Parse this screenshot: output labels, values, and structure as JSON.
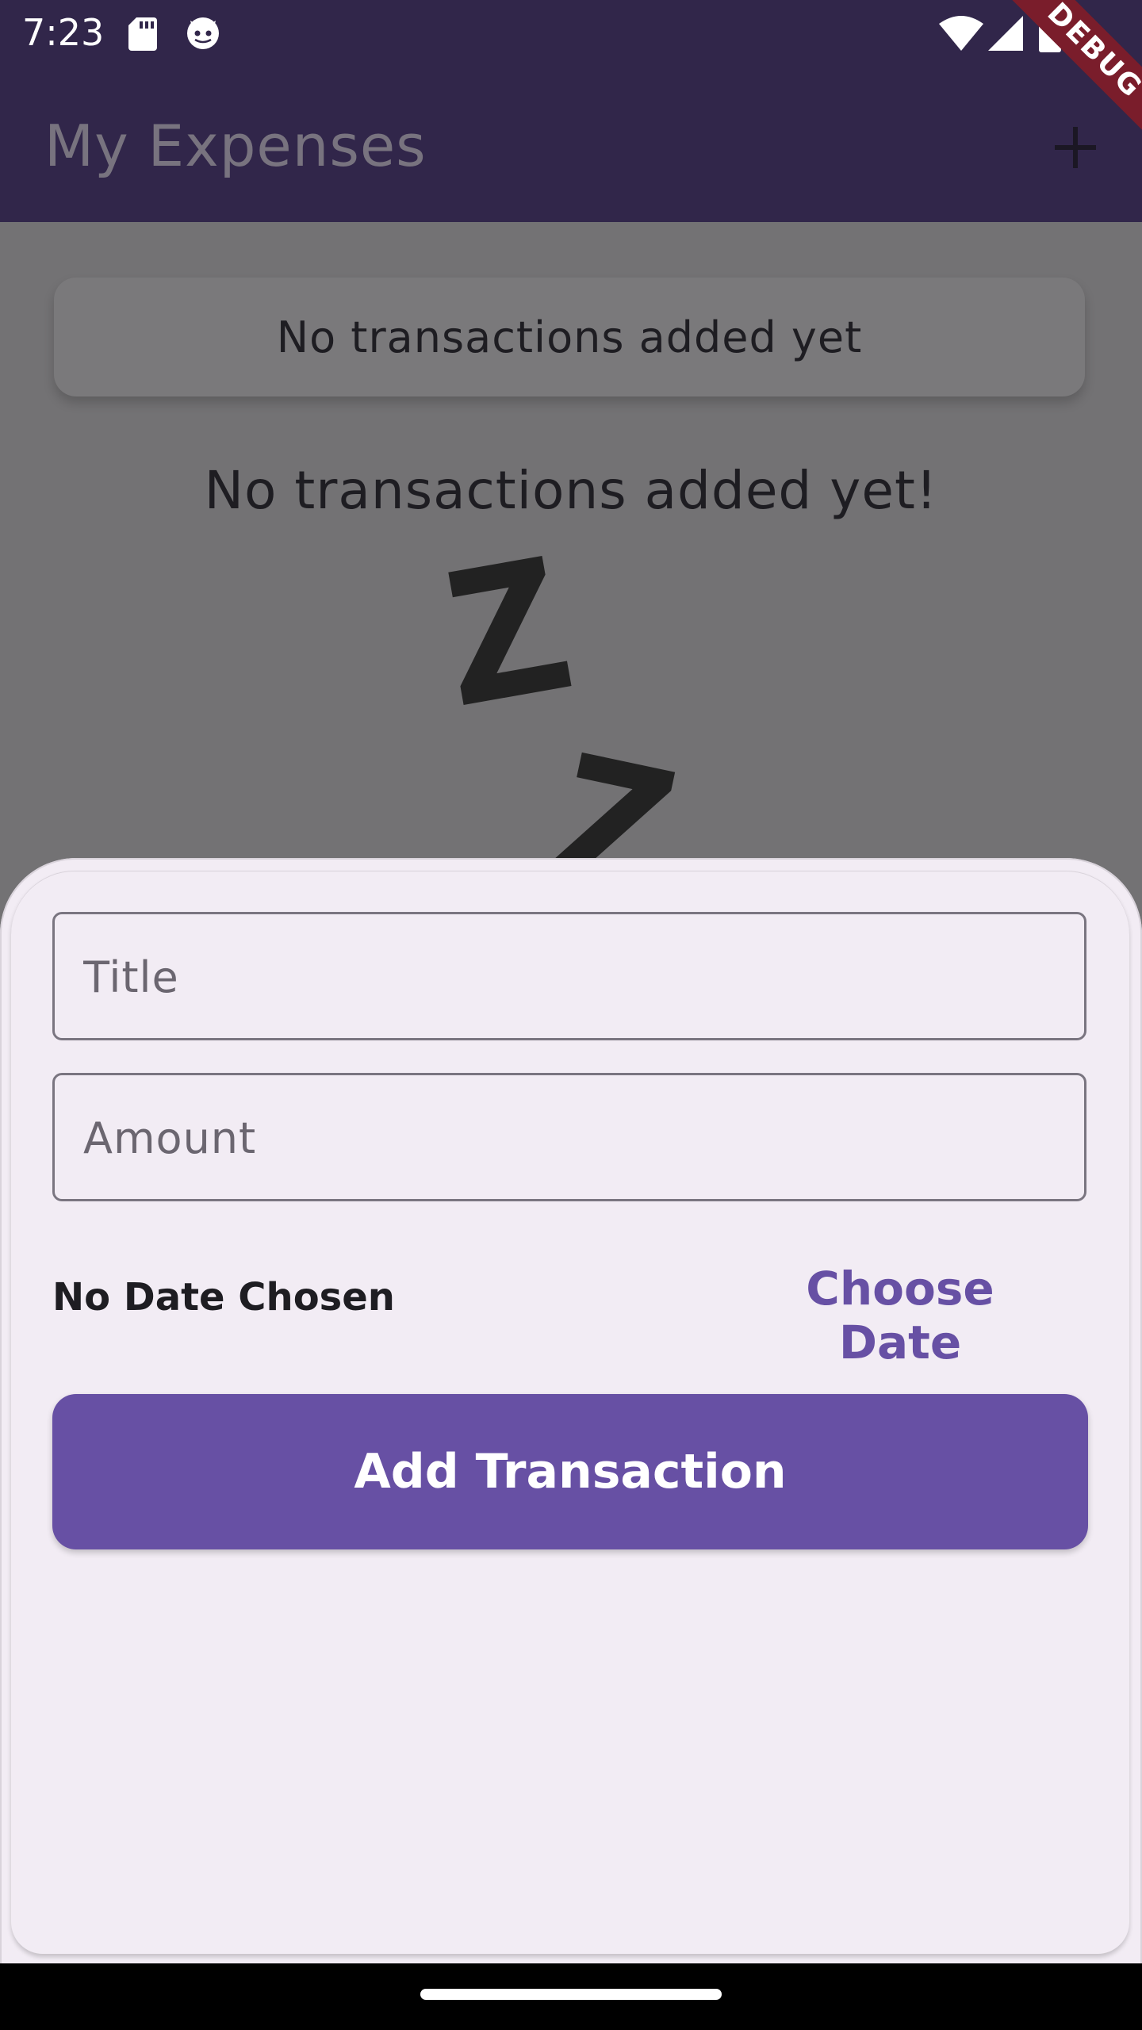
{
  "status_bar": {
    "time": "7:23"
  },
  "app_bar": {
    "title": "My Expenses"
  },
  "debug_banner": {
    "label": "DEBUG"
  },
  "chart_summary": {
    "text": "No transactions added yet"
  },
  "empty_state": {
    "heading": "No transactions added yet!"
  },
  "form": {
    "title_placeholder": "Title",
    "amount_placeholder": "Amount",
    "date_text": "No Date Chosen",
    "choose_date_label": "Choose Date",
    "submit_label": "Add Transaction"
  },
  "colors": {
    "app_bar": "#31264a",
    "primary": "#6750a4",
    "sheet_bg": "#f2ecf4",
    "scrim_bg": "#737274",
    "debug_banner": "#7a1d2b"
  },
  "icons": {
    "add": "add-icon",
    "sd_card": "sd-card-icon",
    "android_bot": "android-bot-icon",
    "wifi": "wifi-icon",
    "signal": "signal-icon",
    "battery": "battery-icon"
  }
}
